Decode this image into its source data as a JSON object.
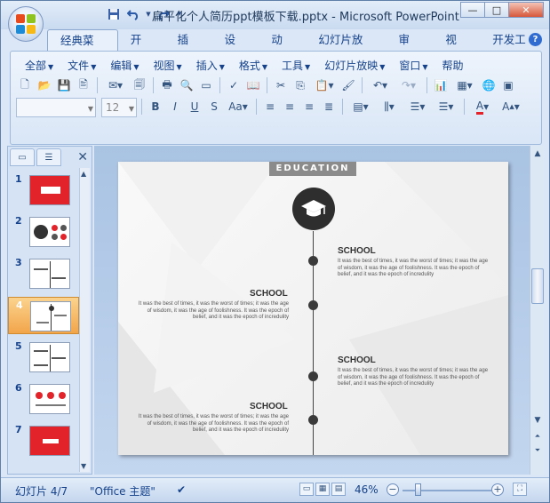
{
  "window": {
    "title": "扁平化个人简历ppt模板下载.pptx - Microsoft PowerPoint",
    "min_label": "—",
    "max_label": "□",
    "close_label": "✕"
  },
  "qat": {
    "save_icon": "save-icon",
    "undo_icon": "undo-icon",
    "redo_icon": "redo-icon",
    "customize_icon": "customize-icon"
  },
  "ribbon_tabs": [
    "经典菜单",
    "开始",
    "插入",
    "设计",
    "动画",
    "幻灯片放映",
    "审阅",
    "视图",
    "开发工具"
  ],
  "active_tab": "经典菜单",
  "menus": [
    "全部",
    "文件",
    "编辑",
    "视图",
    "插入",
    "格式",
    "工具",
    "幻灯片放映",
    "窗口",
    "帮助"
  ],
  "font_size_value": "12",
  "font_name_value": "",
  "thumbnails": [
    {
      "num": "1"
    },
    {
      "num": "2"
    },
    {
      "num": "3"
    },
    {
      "num": "4"
    },
    {
      "num": "5"
    },
    {
      "num": "6"
    },
    {
      "num": "7"
    }
  ],
  "selected_slide": 4,
  "slide": {
    "header": "EDUCATION",
    "entries": [
      {
        "school": "SCHOOL",
        "text": "It was the best of times, it was the worst of times; it was the age of wisdom, it was the age of foolishness. It was the epoch of belief, and it was the epoch of incredulity"
      },
      {
        "school": "SCHOOL",
        "text": "It was the best of times, it was the worst of times; it was the age of wisdom, it was the age of foolishness. It was the epoch of belief, and it was the epoch of incredulity"
      },
      {
        "school": "SCHOOL",
        "text": "It was the best of times, it was the worst of times; it was the age of wisdom, it was the age of foolishness. It was the epoch of belief, and it was the epoch of incredulity"
      },
      {
        "school": "SCHOOL",
        "text": "It was the best of times, it was the worst of times; it was the age of wisdom, it was the age of foolishness. It was the epoch of belief, and it was the epoch of incredulity"
      }
    ]
  },
  "status": {
    "slide_info": "幻灯片 4/7",
    "theme": "\"Office 主题\"",
    "zoom": "46%"
  },
  "colors": {
    "accent_red": "#e2242a",
    "selected_thumb": "#f2a54a",
    "ui_text": "#15428b"
  }
}
